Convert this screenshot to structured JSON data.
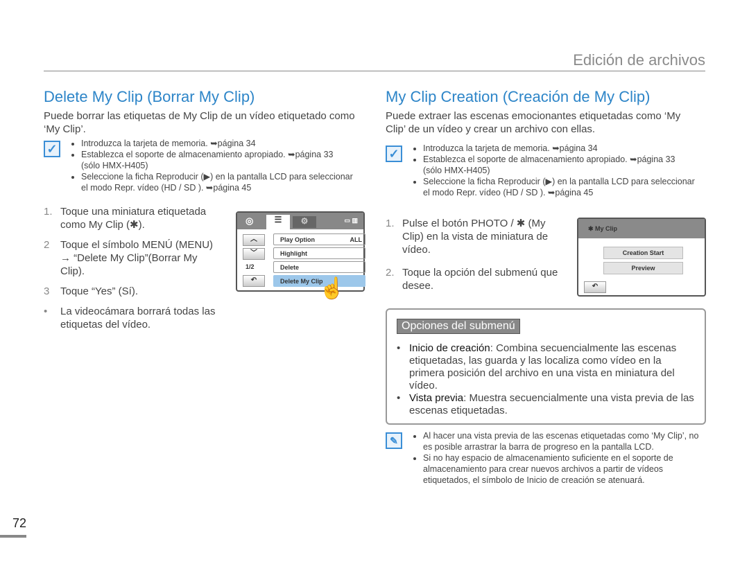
{
  "header": {
    "title": "Edición de archivos"
  },
  "left": {
    "title": "Delete My Clip (Borrar My Clip)",
    "intro": "Puede borrar las etiquetas de My Clip de un vídeo etiquetado como ‘My Clip’.",
    "notes": [
      "Introduzca la tarjeta de memoria. ➥página 34",
      "Establezca el soporte de almacenamiento apropiado. ➥página 33 (sólo HMX-H405)",
      "Seleccione la ficha Reproducir (▶) en la pantalla LCD para seleccionar el modo Repr. vídeo (HD / SD ). ➥página 45"
    ],
    "steps": [
      {
        "n": "1.",
        "text": "Toque una miniatura etiquetada como My Clip (✱)."
      },
      {
        "n": "2",
        "text": "Toque el símbolo MENÚ (MENU) → “Delete My Clip”(Borrar My Clip)."
      },
      {
        "n": "3",
        "text": "Toque “Yes” (Sí)."
      }
    ],
    "bullet": "La videocámara borrará todas las etiquetas del vídeo.",
    "lcd": {
      "items": [
        "Play Option",
        "Highlight",
        "Delete",
        "Delete My Clip"
      ],
      "page": "1/2",
      "play_option_value": "ALL"
    }
  },
  "right": {
    "title": "My Clip Creation (Creación de My Clip)",
    "intro": "Puede extraer las escenas emocionantes etiquetadas como ‘My Clip’ de un vídeo y crear un archivo con ellas.",
    "notes": [
      "Introduzca la tarjeta de memoria. ➥página 34",
      "Establezca el soporte de almacenamiento apropiado. ➥página 33 (sólo HMX-H405)",
      "Seleccione la ficha Reproducir (▶) en la pantalla LCD para seleccionar el modo Repr. vídeo (HD / SD ). ➥página 45"
    ],
    "steps": [
      {
        "n": "1.",
        "text": "Pulse el botón PHOTO / ✱ (My Clip) en la vista de miniatura de vídeo."
      },
      {
        "n": "2.",
        "text": "Toque la opción del submenú que desee."
      }
    ],
    "lcd": {
      "title": "My Clip",
      "buttons": [
        "Creation Start",
        "Preview"
      ]
    },
    "submenu": {
      "title": "Opciones del submenú",
      "items": [
        {
          "term": "Inicio de creación",
          "desc": ": Combina secuencialmente las escenas etiquetadas, las guarda y las localiza como vídeo en la primera posición del archivo en una vista en miniatura del vídeo."
        },
        {
          "term": "Vista previa",
          "desc": ": Muestra secuencialmente una vista previa de las escenas etiquetadas."
        }
      ]
    },
    "tips": [
      "Al hacer una vista previa de las escenas etiquetadas como ‘My Clip’, no es posible arrastrar la barra de progreso en la pantalla LCD.",
      "Si no hay espacio de almacenamiento suficiente en el soporte de almacenamiento para crear nuevos archivos a partir de vídeos etiquetados, el símbolo de Inicio de creación se atenuará."
    ]
  },
  "page_number": "72"
}
